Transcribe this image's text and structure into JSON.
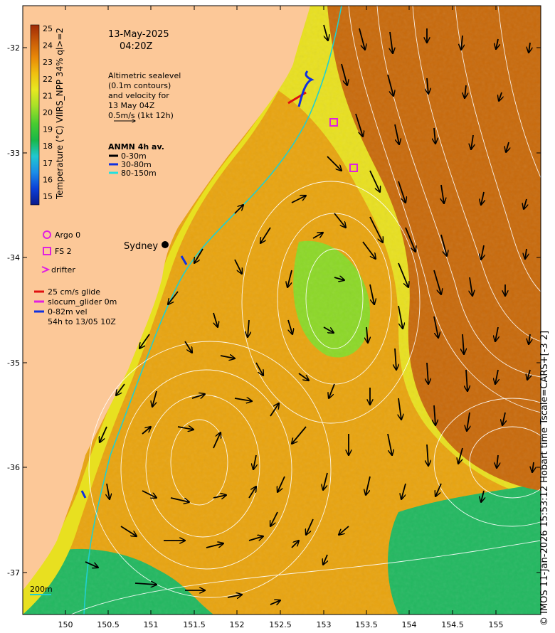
{
  "title": {
    "date": "13-May-2025",
    "time": "04:20Z"
  },
  "colorbar": {
    "label": "Temperature (°C) VIIRS_NPP 34% ql>=2",
    "min": 15,
    "max": 25,
    "ticks": [
      "25",
      "24",
      "23",
      "22",
      "21",
      "20",
      "19",
      "18",
      "17",
      "16",
      "15"
    ],
    "colors": [
      "#0a1a8c",
      "#0b3fd8",
      "#1b8de8",
      "#20c8d0",
      "#18b848",
      "#48cc30",
      "#a8e028",
      "#e8e820",
      "#f0c010",
      "#e88808",
      "#c85a08",
      "#a02a06"
    ]
  },
  "altimetry_note": [
    "Altimetric sealevel",
    "(0.1m contours)",
    "and velocity for",
    "13 May 04Z",
    "0.5m/s (1kt 12h)"
  ],
  "anmn": {
    "title": "ANMN 4h av.",
    "items": [
      {
        "label": "0-30m",
        "color": "#000000"
      },
      {
        "label": "30-80m",
        "color": "#1030e0"
      },
      {
        "label": "80-150m",
        "color": "#20e0e0"
      }
    ]
  },
  "markers": {
    "argo": "Argo 0",
    "fs": "FS 2",
    "drifter": "drifter",
    "sydney": "Sydney",
    "marker_color": "#e020e0"
  },
  "glider": {
    "lines": [
      "25 cm/s glide",
      "slocum_glider 0m",
      "0-82m vel",
      "54h to 13/05 10Z"
    ],
    "colors": [
      "#e01010",
      "#e020e0",
      "#1030e0"
    ]
  },
  "scale_label": "200m",
  "axes": {
    "x_ticks": [
      "150",
      "150.5",
      "151",
      "151.5",
      "152",
      "152.5",
      "153",
      "153.5",
      "154",
      "154.5",
      "155"
    ],
    "y_ticks": [
      "-32",
      "-33",
      "-34",
      "-35",
      "-36",
      "-37"
    ]
  },
  "colors": {
    "land": "#fcc898",
    "sst_warm": "#c86a0c",
    "sst_mid": "#e8a410",
    "sst_yellow": "#e8e020",
    "sst_green": "#8cd828",
    "sst_deep_green": "#22b860",
    "isobath": "#20d0d0",
    "contour": "#ffffff"
  },
  "watermark": "© IMOS 11-Jan-2026 15:53:12 Hobart time Tscale=CARS+[-3 2]"
}
